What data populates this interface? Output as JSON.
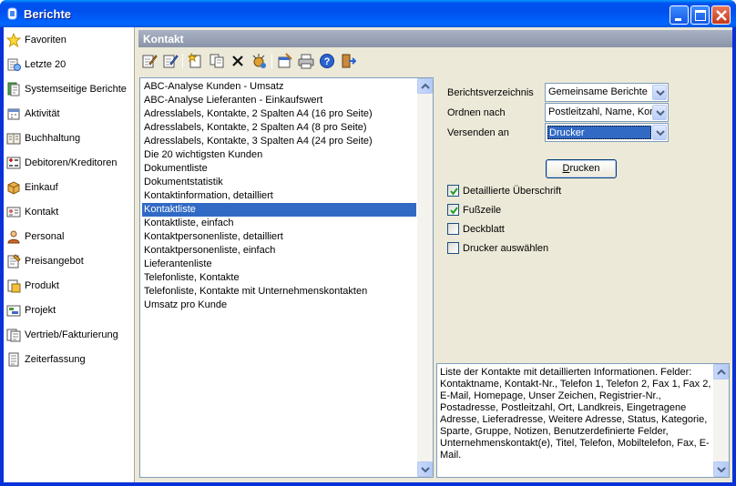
{
  "window": {
    "title": "Berichte"
  },
  "sidebar": {
    "items": [
      {
        "label": "Favoriten",
        "icon": "star-icon"
      },
      {
        "label": "Letzte 20",
        "icon": "recent-icon"
      },
      {
        "label": "Systemseitige Berichte",
        "icon": "system-reports-icon"
      },
      {
        "label": "Aktivität",
        "icon": "activity-icon"
      },
      {
        "label": "Buchhaltung",
        "icon": "accounting-icon"
      },
      {
        "label": "Debitoren/Kreditoren",
        "icon": "debtors-icon"
      },
      {
        "label": "Einkauf",
        "icon": "purchase-icon"
      },
      {
        "label": "Kontakt",
        "icon": "contact-icon"
      },
      {
        "label": "Personal",
        "icon": "personnel-icon"
      },
      {
        "label": "Preisangebot",
        "icon": "quote-icon"
      },
      {
        "label": "Produkt",
        "icon": "product-icon"
      },
      {
        "label": "Projekt",
        "icon": "project-icon"
      },
      {
        "label": "Vertrieb/Fakturierung",
        "icon": "sales-icon"
      },
      {
        "label": "Zeiterfassung",
        "icon": "timesheet-icon"
      }
    ]
  },
  "content": {
    "header": "Kontakt",
    "toolbar": [
      "edit-icon",
      "edit-alt-icon",
      "new-icon",
      "copy-icon",
      "delete-icon",
      "wizard-icon",
      "properties-icon",
      "print-icon",
      "help-icon",
      "exit-icon"
    ]
  },
  "reports": {
    "selected_index": 9,
    "items": [
      "ABC-Analyse Kunden - Umsatz",
      "ABC-Analyse Lieferanten - Einkaufswert",
      "Adresslabels, Kontakte, 2 Spalten A4 (16 pro Seite)",
      "Adresslabels, Kontakte, 2 Spalten A4 (8 pro Seite)",
      "Adresslabels, Kontakte, 3 Spalten A4 (24 pro Seite)",
      "Die 20 wichtigsten Kunden",
      "Dokumentliste",
      "Dokumentstatistik",
      "Kontaktinformation, detailliert",
      "Kontaktliste",
      "Kontaktliste, einfach",
      "Kontaktpersonenliste, detailliert",
      "Kontaktpersonenliste, einfach",
      "Lieferantenliste",
      "Telefonliste, Kontakte",
      "Telefonliste, Kontakte mit Unternehmenskontakten",
      "Umsatz pro Kunde"
    ]
  },
  "options": {
    "directory_label": "Berichtsverzeichnis",
    "directory_value": "Gemeinsame Berichte",
    "sort_label": "Ordnen nach",
    "sort_value": "Postleitzahl, Name, Kontaktnummer",
    "send_label": "Versenden an",
    "send_value": "Drucker",
    "print_button": "Drucken",
    "checkboxes": [
      {
        "label": "Detaillierte Überschrift",
        "checked": true
      },
      {
        "label": "Fußzeile",
        "checked": true
      },
      {
        "label": "Deckblatt",
        "checked": false
      },
      {
        "label": "Drucker auswählen",
        "checked": false
      }
    ]
  },
  "description": "Liste der Kontakte mit detaillierten Informationen. Felder: Kontaktname, Kontakt-Nr., Telefon 1, Telefon 2, Fax 1, Fax 2, E-Mail, Homepage, Unser Zeichen, Registrier-Nr., Postadresse, Postleitzahl, Ort, Landkreis, Eingetragene Adresse, Lieferadresse, Weitere Adresse, Status, Kategorie, Sparte, Gruppe, Notizen, Benutzerdefinierte Felder, Unternehmenskontakt(e), Titel, Telefon, Mobiltelefon, Fax, E-Mail.",
  "colors": {
    "titlebar": "#0055ea",
    "selection": "#316ac5",
    "panel": "#ece9d8"
  }
}
